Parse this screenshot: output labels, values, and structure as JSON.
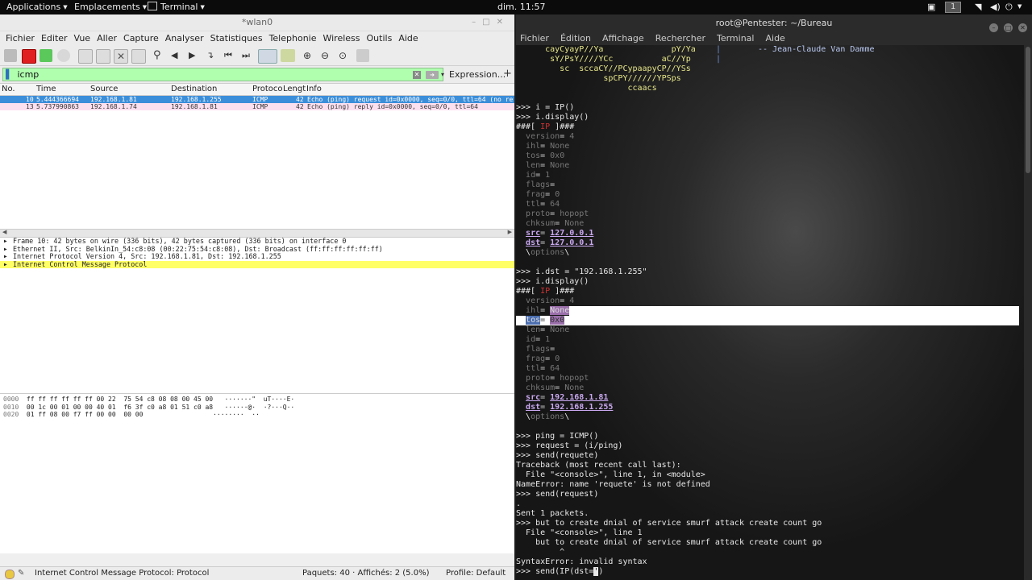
{
  "topbar": {
    "applications": "Applications",
    "places": "Emplacements",
    "terminal": "Terminal",
    "clock": "dim. 11:57",
    "workspace": "1"
  },
  "wireshark": {
    "title": "*wlan0",
    "menu": [
      "Fichier",
      "Editer",
      "Vue",
      "Aller",
      "Capture",
      "Analyser",
      "Statistiques",
      "Telephonie",
      "Wireless",
      "Outils",
      "Aide"
    ],
    "filter": "icmp",
    "expression_label": "Expression...",
    "plus": "+",
    "columns": [
      "No.",
      "Time",
      "Source",
      "Destination",
      "Protoco",
      "Lengt",
      "Info"
    ],
    "packets": [
      {
        "no": "10",
        "time": "5.444366694",
        "src": "192.168.1.81",
        "dst": "192.168.1.255",
        "proto": "ICMP",
        "len": "42",
        "info": "Echo (ping) request  id=0x0000, seq=0/0, ttl=64 (no re"
      },
      {
        "no": "13",
        "time": "5.737990863",
        "src": "192.168.1.74",
        "dst": "192.168.1.81",
        "proto": "ICMP",
        "len": "42",
        "info": "Echo (ping) reply    id=0x0000, seq=0/0, ttl=64"
      }
    ],
    "details": [
      "Frame 10: 42 bytes on wire (336 bits), 42 bytes captured (336 bits) on interface 0",
      "Ethernet II, Src: BelkinIn_54:c8:08 (00:22:75:54:c8:08), Dst: Broadcast (ff:ff:ff:ff:ff:ff)",
      "Internet Protocol Version 4, Src: 192.168.1.81, Dst: 192.168.1.255",
      "Internet Control Message Protocol"
    ],
    "bytes": [
      {
        "off": "0000",
        "hex": "ff ff ff ff ff ff 00 22  75 54 c8 08 08 00 45 00",
        "ascii": "·······\"  uT····E·"
      },
      {
        "off": "0010",
        "hex": "00 1c 00 01 00 00 40 01  f6 3f c0 a8 01 51 c0 a8",
        "ascii": "······@·  ·?···Q··"
      },
      {
        "off": "0020",
        "hex": "01 ff 08 00 f7 ff 00 00  00 00",
        "ascii": "········  ··"
      }
    ],
    "status": {
      "field": "Internet Control Message Protocol: Protocol",
      "packets": "Paquets: 40 · Affichés: 2 (5.0%)",
      "profile": "Profile: Default"
    }
  },
  "terminal": {
    "title": "root@Pentester: ~/Bureau",
    "menu": [
      "Fichier",
      "Édition",
      "Affichage",
      "Rechercher",
      "Terminal",
      "Aide"
    ],
    "art": [
      "      cayCyayP//Ya              pY/Ya",
      "       sY/PsY////YCc          aC//Yp",
      "         sc  sccaCY//PCypaapyCP//YSs",
      "                  spCPY//////YPSps",
      "                       ccaacs"
    ],
    "quote": "-- Jean-Claude Van Damme",
    "cmd1": ">>> i = IP()",
    "cmd2": ">>> i.display()",
    "ip_header_open": "###[ ",
    "ip_label": "IP",
    "ip_header_close": " ]###",
    "fields1": [
      [
        "version",
        "4"
      ],
      [
        "ihl",
        "None"
      ],
      [
        "tos",
        "0x0"
      ],
      [
        "len",
        "None"
      ],
      [
        "id",
        "1"
      ],
      [
        "flags",
        ""
      ],
      [
        "frag",
        "0"
      ],
      [
        "ttl",
        "64"
      ],
      [
        "proto",
        "hopopt"
      ],
      [
        "chksum",
        "None"
      ]
    ],
    "src1": "127.0.0.1",
    "dst1": "127.0.0.1",
    "options": "options",
    "cmd3": ">>> i.dst = \"192.168.1.255\"",
    "cmd4": ">>> i.display()",
    "fields2": [
      [
        "version",
        "4"
      ],
      [
        "ihl",
        "None"
      ],
      [
        "tos",
        "0x0"
      ],
      [
        "len",
        "None"
      ],
      [
        "id",
        "1"
      ],
      [
        "flags",
        ""
      ],
      [
        "frag",
        "0"
      ],
      [
        "ttl",
        "64"
      ],
      [
        "proto",
        "hopopt"
      ],
      [
        "chksum",
        "None"
      ]
    ],
    "src2": "192.168.1.81",
    "dst2": "192.168.1.255",
    "tail": [
      ">>> ping = ICMP()",
      ">>> request = (i/ping)",
      ">>> send(requete)",
      "Traceback (most recent call last):",
      "  File \"<console>\", line 1, in <module>",
      "NameError: name 'requete' is not defined",
      ">>> send(request)",
      ".",
      "Sent 1 packets.",
      ">>> but to create dnial of service smurf attack create count go",
      "  File \"<console>\", line 1",
      "    but to create dnial of service smurf attack create count go",
      "         ^",
      "SyntaxError: invalid syntax"
    ],
    "prompt_last": ">>> send(IP(dst=",
    "cursor": "'"
  }
}
